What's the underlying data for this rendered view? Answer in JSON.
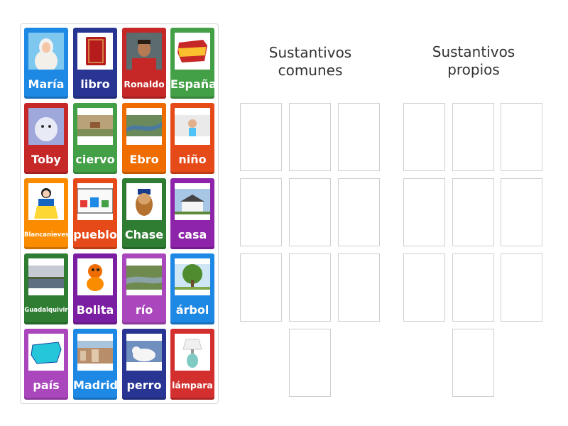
{
  "cards": [
    {
      "label": "María",
      "color": "#1e88e5",
      "icon": "virgin-mary-image"
    },
    {
      "label": "libro",
      "color": "#283593",
      "icon": "book-image"
    },
    {
      "label": "Ronaldo",
      "color": "#c62828",
      "icon": "ronaldo-photo"
    },
    {
      "label": "España",
      "color": "#43a047",
      "icon": "spain-flag-map"
    },
    {
      "label": "Toby",
      "color": "#c62828",
      "icon": "dog-photo"
    },
    {
      "label": "ciervo",
      "color": "#43a047",
      "icon": "deer-photo"
    },
    {
      "label": "Ebro",
      "color": "#ef6c00",
      "icon": "river-aerial-photo"
    },
    {
      "label": "niño",
      "color": "#e64a19",
      "icon": "child-photo"
    },
    {
      "label": "Blancanieves",
      "color": "#fb8c00",
      "icon": "snow-white-image"
    },
    {
      "label": "pueblo",
      "color": "#e64a19",
      "icon": "village-drawing"
    },
    {
      "label": "Chase",
      "color": "#2e7d32",
      "icon": "cartoon-dog-image"
    },
    {
      "label": "casa",
      "color": "#8e24aa",
      "icon": "house-photo"
    },
    {
      "label": "Guadalquivir",
      "color": "#2e7d32",
      "icon": "river-landscape-photo"
    },
    {
      "label": "Bolita",
      "color": "#7b1fa2",
      "icon": "cartoon-character-image"
    },
    {
      "label": "río",
      "color": "#ab47bc",
      "icon": "river-photo"
    },
    {
      "label": "árbol",
      "color": "#1e88e5",
      "icon": "tree-photo"
    },
    {
      "label": "país",
      "color": "#ab47bc",
      "icon": "spain-map"
    },
    {
      "label": "Madrid",
      "color": "#1e88e5",
      "icon": "city-photo"
    },
    {
      "label": "perro",
      "color": "#283593",
      "icon": "white-dog-photo"
    },
    {
      "label": "lámpara",
      "color": "#d32f2f",
      "icon": "lamp-photo"
    }
  ],
  "groups": [
    {
      "title_line1": "Sustantivos",
      "title_line2": "comunes",
      "slots": 10
    },
    {
      "title_line1": "Sustantivos",
      "title_line2": "propios",
      "slots": 10
    }
  ]
}
